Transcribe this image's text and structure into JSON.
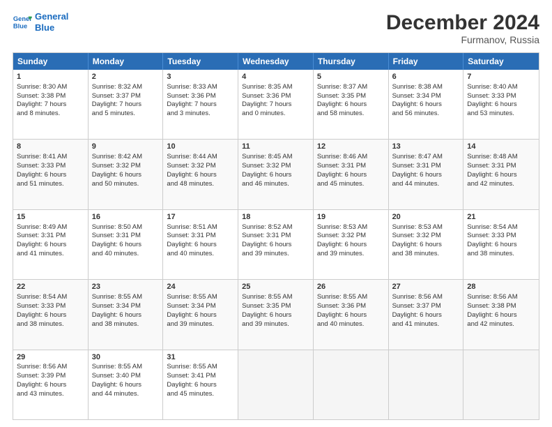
{
  "header": {
    "logo_line1": "General",
    "logo_line2": "Blue",
    "month": "December 2024",
    "location": "Furmanov, Russia"
  },
  "weekdays": [
    "Sunday",
    "Monday",
    "Tuesday",
    "Wednesday",
    "Thursday",
    "Friday",
    "Saturday"
  ],
  "rows": [
    [
      {
        "day": "1",
        "lines": [
          "Sunrise: 8:30 AM",
          "Sunset: 3:38 PM",
          "Daylight: 7 hours",
          "and 8 minutes."
        ]
      },
      {
        "day": "2",
        "lines": [
          "Sunrise: 8:32 AM",
          "Sunset: 3:37 PM",
          "Daylight: 7 hours",
          "and 5 minutes."
        ]
      },
      {
        "day": "3",
        "lines": [
          "Sunrise: 8:33 AM",
          "Sunset: 3:36 PM",
          "Daylight: 7 hours",
          "and 3 minutes."
        ]
      },
      {
        "day": "4",
        "lines": [
          "Sunrise: 8:35 AM",
          "Sunset: 3:36 PM",
          "Daylight: 7 hours",
          "and 0 minutes."
        ]
      },
      {
        "day": "5",
        "lines": [
          "Sunrise: 8:37 AM",
          "Sunset: 3:35 PM",
          "Daylight: 6 hours",
          "and 58 minutes."
        ]
      },
      {
        "day": "6",
        "lines": [
          "Sunrise: 8:38 AM",
          "Sunset: 3:34 PM",
          "Daylight: 6 hours",
          "and 56 minutes."
        ]
      },
      {
        "day": "7",
        "lines": [
          "Sunrise: 8:40 AM",
          "Sunset: 3:33 PM",
          "Daylight: 6 hours",
          "and 53 minutes."
        ]
      }
    ],
    [
      {
        "day": "8",
        "lines": [
          "Sunrise: 8:41 AM",
          "Sunset: 3:33 PM",
          "Daylight: 6 hours",
          "and 51 minutes."
        ]
      },
      {
        "day": "9",
        "lines": [
          "Sunrise: 8:42 AM",
          "Sunset: 3:32 PM",
          "Daylight: 6 hours",
          "and 50 minutes."
        ]
      },
      {
        "day": "10",
        "lines": [
          "Sunrise: 8:44 AM",
          "Sunset: 3:32 PM",
          "Daylight: 6 hours",
          "and 48 minutes."
        ]
      },
      {
        "day": "11",
        "lines": [
          "Sunrise: 8:45 AM",
          "Sunset: 3:32 PM",
          "Daylight: 6 hours",
          "and 46 minutes."
        ]
      },
      {
        "day": "12",
        "lines": [
          "Sunrise: 8:46 AM",
          "Sunset: 3:31 PM",
          "Daylight: 6 hours",
          "and 45 minutes."
        ]
      },
      {
        "day": "13",
        "lines": [
          "Sunrise: 8:47 AM",
          "Sunset: 3:31 PM",
          "Daylight: 6 hours",
          "and 44 minutes."
        ]
      },
      {
        "day": "14",
        "lines": [
          "Sunrise: 8:48 AM",
          "Sunset: 3:31 PM",
          "Daylight: 6 hours",
          "and 42 minutes."
        ]
      }
    ],
    [
      {
        "day": "15",
        "lines": [
          "Sunrise: 8:49 AM",
          "Sunset: 3:31 PM",
          "Daylight: 6 hours",
          "and 41 minutes."
        ]
      },
      {
        "day": "16",
        "lines": [
          "Sunrise: 8:50 AM",
          "Sunset: 3:31 PM",
          "Daylight: 6 hours",
          "and 40 minutes."
        ]
      },
      {
        "day": "17",
        "lines": [
          "Sunrise: 8:51 AM",
          "Sunset: 3:31 PM",
          "Daylight: 6 hours",
          "and 40 minutes."
        ]
      },
      {
        "day": "18",
        "lines": [
          "Sunrise: 8:52 AM",
          "Sunset: 3:31 PM",
          "Daylight: 6 hours",
          "and 39 minutes."
        ]
      },
      {
        "day": "19",
        "lines": [
          "Sunrise: 8:53 AM",
          "Sunset: 3:32 PM",
          "Daylight: 6 hours",
          "and 39 minutes."
        ]
      },
      {
        "day": "20",
        "lines": [
          "Sunrise: 8:53 AM",
          "Sunset: 3:32 PM",
          "Daylight: 6 hours",
          "and 38 minutes."
        ]
      },
      {
        "day": "21",
        "lines": [
          "Sunrise: 8:54 AM",
          "Sunset: 3:33 PM",
          "Daylight: 6 hours",
          "and 38 minutes."
        ]
      }
    ],
    [
      {
        "day": "22",
        "lines": [
          "Sunrise: 8:54 AM",
          "Sunset: 3:33 PM",
          "Daylight: 6 hours",
          "and 38 minutes."
        ]
      },
      {
        "day": "23",
        "lines": [
          "Sunrise: 8:55 AM",
          "Sunset: 3:34 PM",
          "Daylight: 6 hours",
          "and 38 minutes."
        ]
      },
      {
        "day": "24",
        "lines": [
          "Sunrise: 8:55 AM",
          "Sunset: 3:34 PM",
          "Daylight: 6 hours",
          "and 39 minutes."
        ]
      },
      {
        "day": "25",
        "lines": [
          "Sunrise: 8:55 AM",
          "Sunset: 3:35 PM",
          "Daylight: 6 hours",
          "and 39 minutes."
        ]
      },
      {
        "day": "26",
        "lines": [
          "Sunrise: 8:55 AM",
          "Sunset: 3:36 PM",
          "Daylight: 6 hours",
          "and 40 minutes."
        ]
      },
      {
        "day": "27",
        "lines": [
          "Sunrise: 8:56 AM",
          "Sunset: 3:37 PM",
          "Daylight: 6 hours",
          "and 41 minutes."
        ]
      },
      {
        "day": "28",
        "lines": [
          "Sunrise: 8:56 AM",
          "Sunset: 3:38 PM",
          "Daylight: 6 hours",
          "and 42 minutes."
        ]
      }
    ],
    [
      {
        "day": "29",
        "lines": [
          "Sunrise: 8:56 AM",
          "Sunset: 3:39 PM",
          "Daylight: 6 hours",
          "and 43 minutes."
        ]
      },
      {
        "day": "30",
        "lines": [
          "Sunrise: 8:55 AM",
          "Sunset: 3:40 PM",
          "Daylight: 6 hours",
          "and 44 minutes."
        ]
      },
      {
        "day": "31",
        "lines": [
          "Sunrise: 8:55 AM",
          "Sunset: 3:41 PM",
          "Daylight: 6 hours",
          "and 45 minutes."
        ]
      },
      {
        "day": "",
        "lines": []
      },
      {
        "day": "",
        "lines": []
      },
      {
        "day": "",
        "lines": []
      },
      {
        "day": "",
        "lines": []
      }
    ]
  ]
}
